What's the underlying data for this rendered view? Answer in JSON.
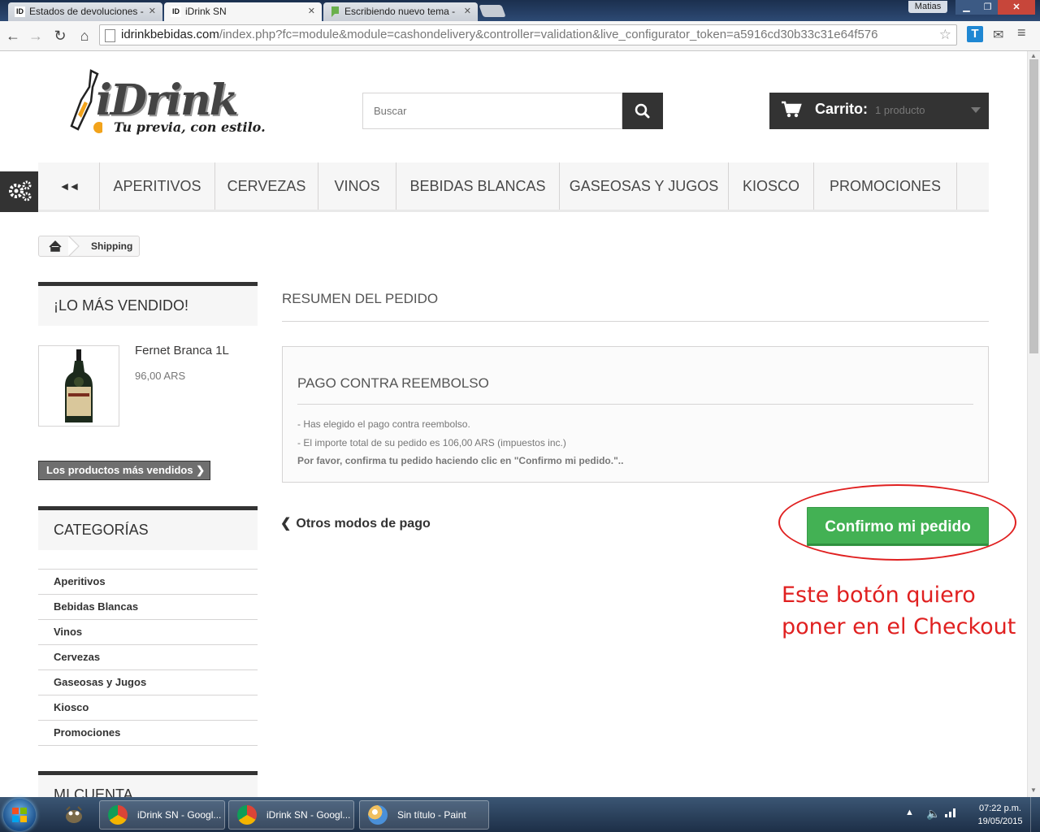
{
  "browser": {
    "tabs": [
      {
        "label": "Estados de devoluciones - ",
        "favicon": "ID"
      },
      {
        "label": "iDrink SN",
        "favicon": "ID"
      },
      {
        "label": "Escribiendo nuevo tema - ",
        "favicon": "forum"
      }
    ],
    "window_user": "Matias",
    "url_host": "idrinkbebidas.com",
    "url_rest": "/index.php?fc=module&module=cashondelivery&controller=validation&live_configurator_token=a5916cd30b33c31e64f576",
    "colors": {
      "accent_green": "#43b154",
      "annotation_red": "#e02020",
      "dark": "#333333"
    }
  },
  "header": {
    "logo_word": "iDrink",
    "logo_tagline": "Tu previa, con estilo.",
    "search_placeholder": "Buscar",
    "cart_label": "Carrito:",
    "cart_count": "1 producto"
  },
  "menu": {
    "back_label": "◄◄",
    "items": [
      "APERITIVOS",
      "CERVEZAS",
      "VINOS",
      "BEBIDAS BLANCAS",
      "GASEOSAS Y JUGOS",
      "KIOSCO",
      "PROMOCIONES"
    ]
  },
  "breadcrumb": {
    "current": "Shipping"
  },
  "sidebar": {
    "best_title": "¡LO MÁS VENDIDO!",
    "product_name": "Fernet Branca 1L",
    "product_price": "96,00 ARS",
    "best_button": "Los productos más vendidos",
    "categories_title": "CATEGORÍAS",
    "categories": [
      "Aperitivos",
      "Bebidas Blancas",
      "Vinos",
      "Cervezas",
      "Gaseosas y Jugos",
      "Kiosco",
      "Promociones"
    ],
    "account_title": "MI CUENTA"
  },
  "main": {
    "order_title": "RESUMEN DEL PEDIDO",
    "payment_title": "PAGO CONTRA REEMBOLSO",
    "line1": "- Has elegido el pago contra reembolso.",
    "line2": "- El importe total de su pedido es 106,00 ARS (impuestos inc.)",
    "line3": "Por favor, confirma tu pedido haciendo clic en \"Confirmo mi pedido.\"..",
    "other_payment": "Otros modos de pago",
    "confirm_button": "Confirmo mi pedido",
    "annotation": "Este botón quiero poner en el Checkout"
  },
  "taskbar": {
    "items": [
      "iDrink SN - Googl...",
      "iDrink SN - Googl...",
      "Sin título - Paint"
    ],
    "time": "07:22 p.m.",
    "date": "19/05/2015"
  }
}
